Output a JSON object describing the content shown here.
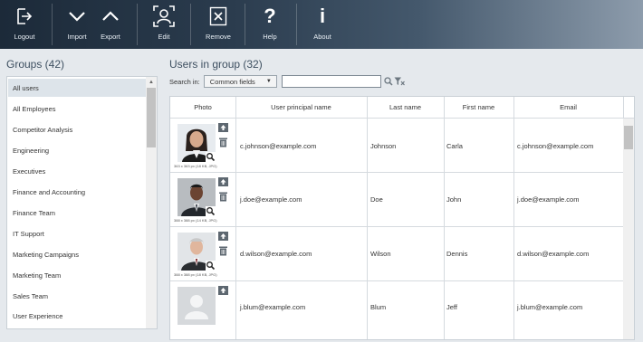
{
  "toolbar": {
    "logout": "Logout",
    "import": "Import",
    "export": "Export",
    "edit": "Edit",
    "remove": "Remove",
    "help": "Help",
    "about": "About"
  },
  "groups": {
    "title": "Groups (42)",
    "items": [
      "All users",
      "All Employees",
      "Competitor Analysis",
      "Engineering",
      "Executives",
      "Finance and Accounting",
      "Finance Team",
      "IT Support",
      "Marketing Campaigns",
      "Marketing Team",
      "Sales Team",
      "User Experience"
    ],
    "selected": "All users"
  },
  "users": {
    "title": "Users in group (32)",
    "search_label": "Search in:",
    "search_scope": "Common fields",
    "search_value": "",
    "columns": [
      "Photo",
      "User principal name",
      "Last name",
      "First name",
      "Email"
    ],
    "rows": [
      {
        "upn": "c.johnson@example.com",
        "last": "Johnson",
        "first": "Carla",
        "email": "c.johnson@example.com",
        "photo_meta": "363 x 363 px (18 KB, JPG)"
      },
      {
        "upn": "j.doe@example.com",
        "last": "Doe",
        "first": "John",
        "email": "j.doe@example.com",
        "photo_meta": "388 x 388 px (14 KB, JPG)"
      },
      {
        "upn": "d.wilson@example.com",
        "last": "Wilson",
        "first": "Dennis",
        "email": "d.wilson@example.com",
        "photo_meta": "388 x 388 px (18 KB, JPG)"
      },
      {
        "upn": "j.blum@example.com",
        "last": "Blum",
        "first": "Jeff",
        "email": "j.blum@example.com",
        "photo_meta": ""
      }
    ]
  },
  "colors": {
    "toolbar_dark": "#1c2a39",
    "toolbar_light": "#8d9cac",
    "selected_row": "#dde4ea",
    "title_text": "#3d4f60"
  }
}
